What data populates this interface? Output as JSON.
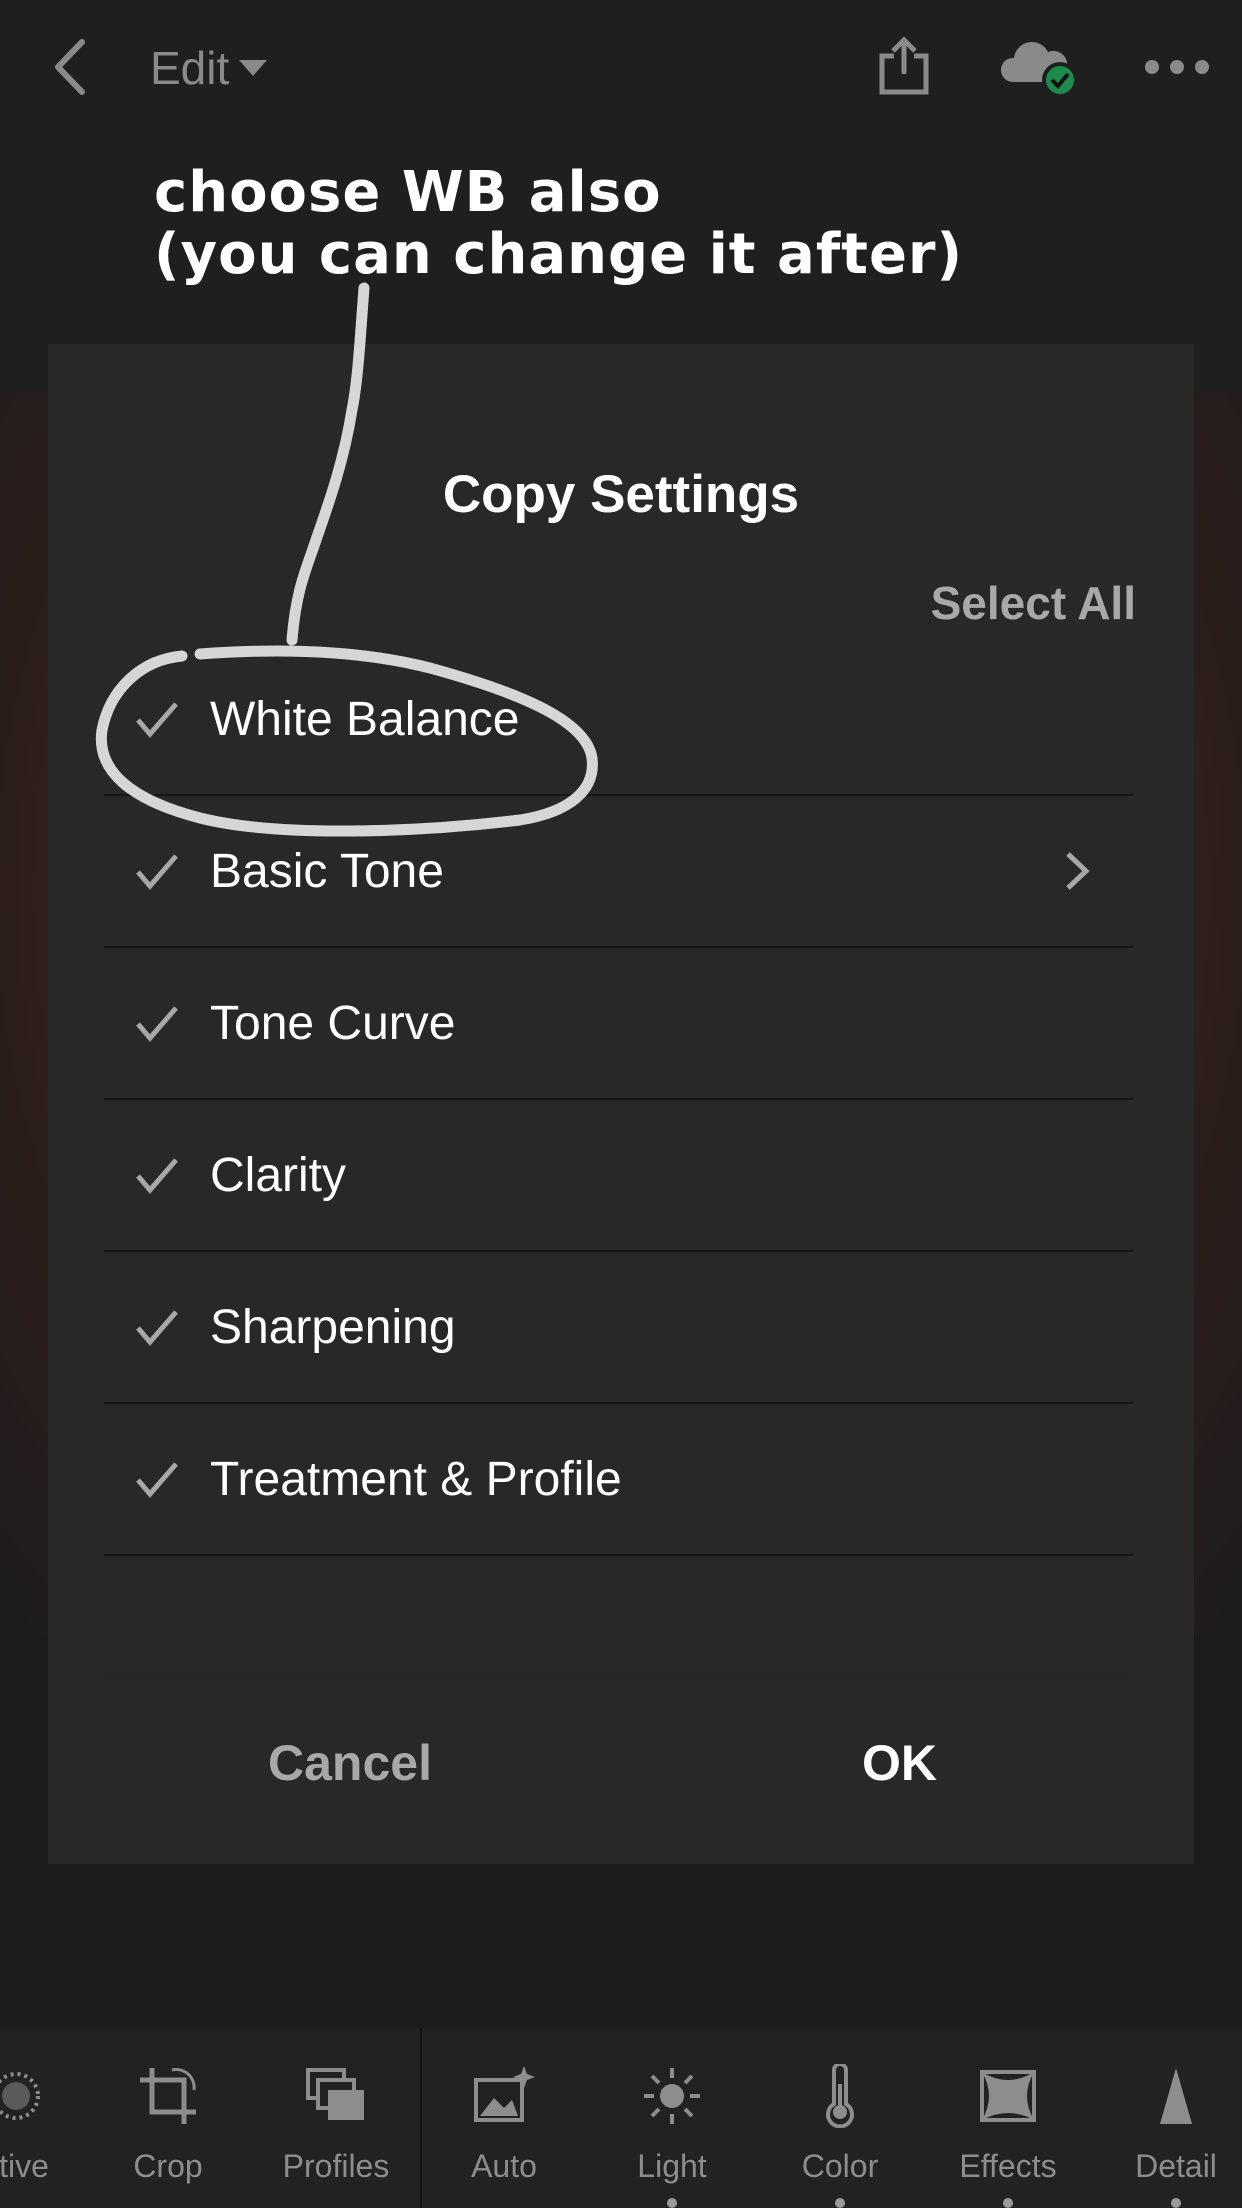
{
  "header": {
    "edit_label": "Edit",
    "icons": [
      "back-arrow-icon",
      "share-icon",
      "cloud-synced-icon",
      "more-icon"
    ],
    "colors": {
      "sync_badge": "#1e8a4c"
    }
  },
  "annotation": {
    "text": "choose WB also\n(you can change it after)"
  },
  "dialog": {
    "title": "Copy Settings",
    "select_all_label": "Select All",
    "items": [
      {
        "label": "White Balance",
        "checked": true
      },
      {
        "label": "Basic Tone",
        "checked": true,
        "has_submenu": true
      },
      {
        "label": "Tone Curve",
        "checked": true
      },
      {
        "label": "Clarity",
        "checked": true
      },
      {
        "label": "Sharpening",
        "checked": true
      },
      {
        "label": "Treatment & Profile",
        "checked": true
      }
    ],
    "cancel_label": "Cancel",
    "ok_label": "OK"
  },
  "toolbar": {
    "tools": [
      {
        "label": "ctive",
        "icon": "selective-icon"
      },
      {
        "label": "Crop",
        "icon": "crop-icon"
      },
      {
        "label": "Profiles",
        "icon": "profiles-icon"
      },
      {
        "label": "Auto",
        "icon": "auto-icon"
      },
      {
        "label": "Light",
        "icon": "light-icon"
      },
      {
        "label": "Color",
        "icon": "color-icon"
      },
      {
        "label": "Effects",
        "icon": "effects-icon"
      },
      {
        "label": "Detail",
        "icon": "detail-icon"
      }
    ]
  }
}
